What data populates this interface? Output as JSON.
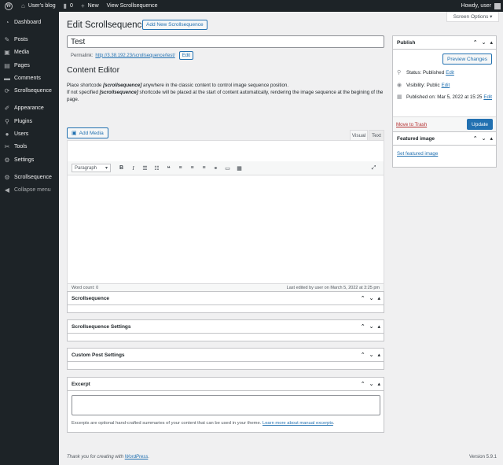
{
  "adminbar": {
    "site_name": "User's blog",
    "comments_count": "0",
    "new_label": "New",
    "view_label": "View Scrollsequence",
    "howdy": "Howdy, user"
  },
  "sidebar": {
    "items": [
      {
        "label": "Dashboard",
        "icon": "dashboard-icon"
      },
      {
        "label": "Posts",
        "icon": "pin-icon"
      },
      {
        "label": "Media",
        "icon": "media-icon"
      },
      {
        "label": "Pages",
        "icon": "page-icon"
      },
      {
        "label": "Comments",
        "icon": "comment-icon"
      },
      {
        "label": "Scrollsequence",
        "icon": "scroll-icon"
      },
      {
        "label": "Appearance",
        "icon": "brush-icon"
      },
      {
        "label": "Plugins",
        "icon": "plugin-icon"
      },
      {
        "label": "Users",
        "icon": "user-icon"
      },
      {
        "label": "Tools",
        "icon": "wrench-icon"
      },
      {
        "label": "Settings",
        "icon": "settings-icon"
      },
      {
        "label": "Scrollsequence",
        "icon": "scroll-icon"
      },
      {
        "label": "Collapse menu",
        "icon": "collapse-icon"
      }
    ]
  },
  "header": {
    "screen_options": "Screen Options ▾",
    "title": "Edit Scrollsequence",
    "add_new": "Add New Scrollsequence"
  },
  "post": {
    "title_value": "Test",
    "permalink_label": "Permalink:",
    "permalink_url": "http://3.38.192.23/scrollsequence/test/",
    "edit_label": "Edit"
  },
  "content_editor": {
    "title": "Content Editor",
    "line1_a": "Place shortcode ",
    "shortcode": "[scrollsequence]",
    "line1_b": " anywhere in the classic content to control image sequence position.",
    "line2_a": "If not specified ",
    "line2_b": " shortcode will be placed at the start of content automatically, rendering the image sequence at the begining of the page."
  },
  "editor": {
    "add_media": "Add Media",
    "tab_visual": "Visual",
    "tab_text": "Text",
    "format": "Paragraph",
    "word_count": "Word count: 0",
    "last_edited": "Last edited by user on March 5, 2022 at 3:25 pm"
  },
  "boxes": {
    "scrollsequence": "Scrollsequence",
    "settings": "Scrollsequence Settings",
    "custom": "Custom Post Settings",
    "excerpt": "Excerpt",
    "excerpt_help": "Excerpts are optional hand-crafted summaries of your content that can be used in your theme.",
    "excerpt_link": "Learn more about manual excerpts",
    "excerpt_period": "."
  },
  "publish": {
    "title": "Publish",
    "preview": "Preview Changes",
    "status_label": "Status:",
    "status_value": "Published",
    "visibility_label": "Visibility:",
    "visibility_value": "Public",
    "published_label": "Published on:",
    "published_value": "Mar 5, 2022 at 15:25",
    "edit": "Edit",
    "trash": "Move to Trash",
    "update": "Update"
  },
  "featured": {
    "title": "Featured image",
    "set": "Set featured image"
  },
  "footer": {
    "thanks": "Thank you for creating with ",
    "wordpress": "WordPress",
    "period": ".",
    "version": "Version 5.9.1"
  }
}
